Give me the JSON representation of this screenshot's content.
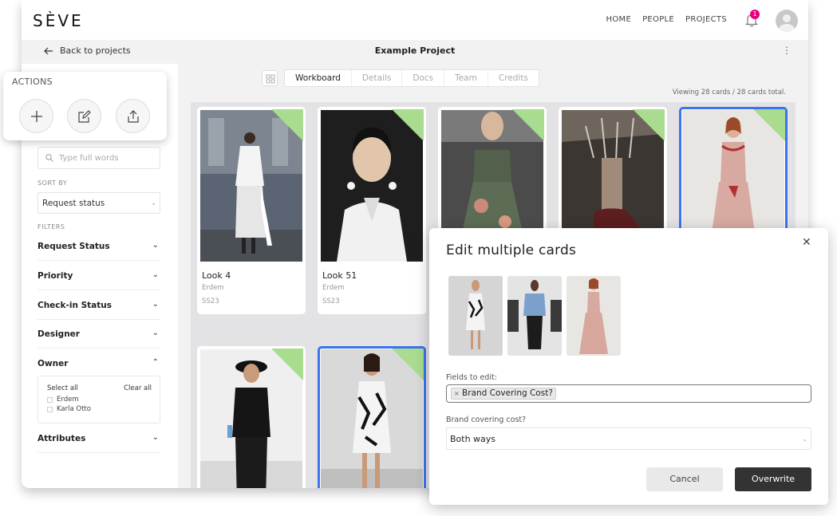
{
  "brand": {
    "logo": "SÈVE"
  },
  "nav": {
    "links": [
      "HOME",
      "PEOPLE",
      "PROJECTS"
    ],
    "notifications_count": "1"
  },
  "subbar": {
    "back_label": "Back to projects",
    "project_title": "Example Project"
  },
  "actions": {
    "heading": "ACTIONS",
    "buttons": [
      "add",
      "edit",
      "share"
    ]
  },
  "sidebar": {
    "search_placeholder": "Type full words",
    "sort_by_label": "SORT BY",
    "sort_value": "Request status",
    "filters_label": "FILTERS",
    "filters": [
      {
        "label": "Request Status",
        "expanded": false
      },
      {
        "label": "Priority",
        "expanded": false
      },
      {
        "label": "Check-in Status",
        "expanded": false
      },
      {
        "label": "Designer",
        "expanded": false
      },
      {
        "label": "Owner",
        "expanded": true
      },
      {
        "label": "Attributes",
        "expanded": false
      }
    ],
    "owner": {
      "select_all": "Select all",
      "clear_all": "Clear all",
      "options": [
        "Erdem",
        "Karla Otto"
      ]
    }
  },
  "board": {
    "tabs": [
      "Workboard",
      "Details",
      "Docs",
      "Team",
      "Credits"
    ],
    "active_tab": "Workboard",
    "viewing_text": "Viewing 28 cards / 28 cards total.",
    "cards": [
      {
        "title": "Look 4",
        "designer": "Erdem",
        "season": "SS23",
        "selected": false
      },
      {
        "title": "Look 51",
        "designer": "Erdem",
        "season": "SS23",
        "selected": false
      },
      {
        "title": "",
        "designer": "",
        "season": "",
        "selected": false
      },
      {
        "title": "",
        "designer": "",
        "season": "",
        "selected": false
      },
      {
        "title": "",
        "designer": "",
        "season": "",
        "selected": true
      },
      {
        "title": "",
        "designer": "",
        "season": "",
        "selected": false
      },
      {
        "title": "",
        "designer": "",
        "season": "",
        "selected": true
      }
    ]
  },
  "modal": {
    "title": "Edit multiple cards",
    "fields_label": "Fields to edit:",
    "field_chip": "Brand Covering Cost?",
    "bcc_label": "Brand covering cost?",
    "bcc_value": "Both ways",
    "cancel_label": "Cancel",
    "overwrite_label": "Overwrite"
  },
  "colors": {
    "accent_blue": "#3b73f0",
    "corner_green": "#a9dc8e",
    "badge_pink": "#e6007e",
    "primary_dark": "#333333"
  }
}
